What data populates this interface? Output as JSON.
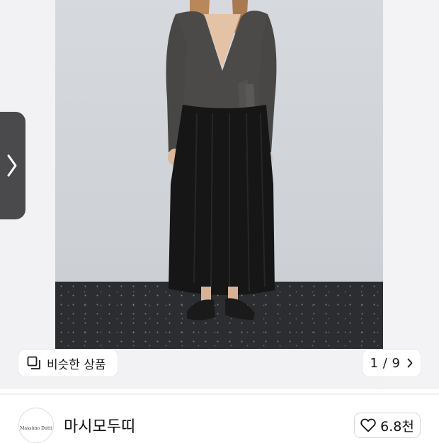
{
  "gallery": {
    "similar_products_label": "비슷한 상품",
    "counter_text": "1 / 9",
    "icons": {
      "similar": "similar-products-icon",
      "prev": "chevron-right-icon",
      "next": "chevron-right-icon"
    }
  },
  "brand": {
    "name": "마시모두띠",
    "logo_text": "Massimo Dutti"
  },
  "like": {
    "count": "6.8천",
    "icon": "heart-outline-icon"
  },
  "colors": {
    "tab_dark": "#4a4a4c",
    "pill_bg": "#ffffff",
    "floor": "#2b2d30"
  }
}
